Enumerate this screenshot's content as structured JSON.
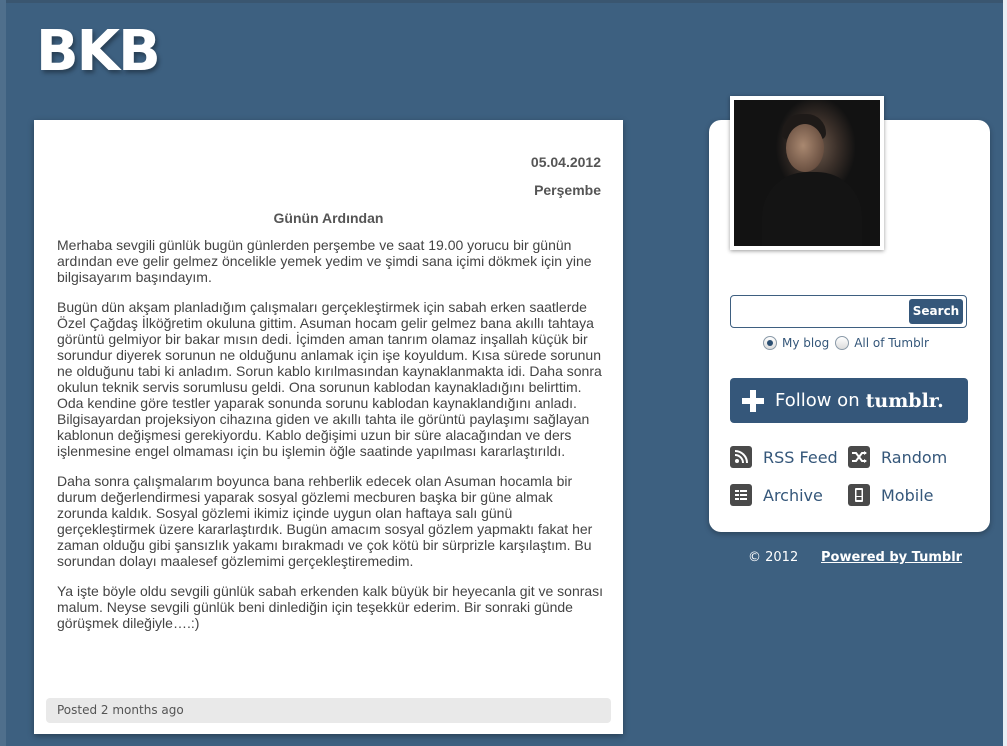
{
  "blog": {
    "title": "BKB"
  },
  "post": {
    "date": "05.04.2012",
    "day": "Perşembe",
    "title": "Günün Ardından",
    "paragraphs": [
      "Merhaba sevgili günlük bugün günlerden perşembe ve saat 19.00 yorucu bir günün ardından eve gelir gelmez öncelikle yemek yedim ve şimdi sana içimi dökmek için yine bilgisayarım başındayım.",
      "Bugün dün akşam planladığım çalışmaları gerçekleştirmek için sabah erken saatlerde Özel Çağdaş İlköğretim okuluna gittim. Asuman hocam gelir gelmez bana akıllı tahtaya görüntü gelmiyor bir bakar mısın dedi. İçimden aman tanrım olamaz inşallah küçük bir sorundur diyerek sorunun ne olduğunu anlamak için işe koyuldum. Kısa sürede sorunun ne olduğunu tabi ki anladım. Sorun kablo kırılmasından kaynaklanmakta idi. Daha sonra okulun teknik servis sorumlusu geldi. Ona sorunun kablodan kaynakladığını belirttim. Oda kendine göre testler yaparak sonunda sorunu kablodan kaynaklandığını anladı. Bilgisayardan projeksiyon cihazına giden ve akıllı tahta ile görüntü paylaşımı sağlayan kablonun değişmesi gerekiyordu. Kablo değişimi uzun bir süre alacağından ve ders işlenmesine engel olmaması için bu işlemin öğle saatinde yapılması kararlaştırıldı.",
      "Daha sonra çalışmalarım boyunca bana rehberlik edecek olan Asuman hocamla bir durum değerlendirmesi yaparak sosyal gözlemi mecburen başka bir güne almak zorunda kaldık. Sosyal gözlemi ikimiz içinde uygun olan haftaya salı günü gerçekleştirmek üzere kararlaştırdık. Bugün amacım sosyal gözlem yapmaktı fakat her zaman olduğu gibi şansızlık yakamı bırakmadı ve çok kötü bir sürprizle karşılaştım. Bu sorundan dolayı maalesef gözlemimi gerçekleştiremedim.",
      "Ya işte böyle oldu sevgili günlük sabah erkenden kalk büyük bir heyecanla git ve sonrası malum. Neyse sevgili günlük beni dinlediğin için teşekkür ederim. Bir sonraki günde görüşmek dileğiyle….:)"
    ],
    "footer": "Posted 2 months ago"
  },
  "sidebar": {
    "search": {
      "value": "",
      "button_label": "Search",
      "scope_my_blog": "My blog",
      "scope_all": "All of Tumblr",
      "selected_scope": "My blog"
    },
    "follow": {
      "label": "Follow on",
      "brand": "tumblr."
    },
    "links": {
      "rss": "RSS Feed",
      "random": "Random",
      "archive": "Archive",
      "mobile": "Mobile"
    }
  },
  "footer": {
    "copyright": "© 2012",
    "powered": "Powered by Tumblr"
  },
  "colors": {
    "background": "#3d6080",
    "accent": "#35577a",
    "text": "#444444"
  },
  "icons": {
    "follow": "plus-icon",
    "rss": "rss-icon",
    "random": "shuffle-icon",
    "archive": "archive-icon",
    "mobile": "mobile-icon"
  }
}
